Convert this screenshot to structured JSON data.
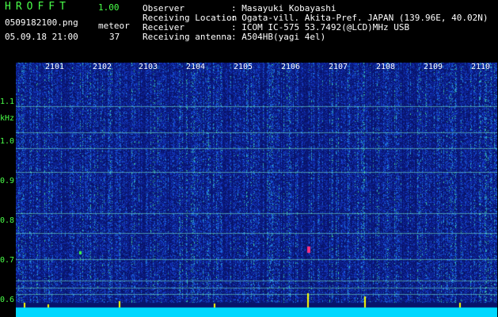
{
  "app": {
    "name": "HROFFT",
    "version": "1.00"
  },
  "file": {
    "name": "0509182100.png",
    "datetime": "05.09.18 21:00"
  },
  "meteor": {
    "label": "meteor",
    "count": "37"
  },
  "info": [
    {
      "label": "Observer",
      "value": ": Masayuki Kobayashi"
    },
    {
      "label": "Receiving Location",
      "value": ": Ogata-vill. Akita-Pref. JAPAN (139.96E, 40.02N)"
    },
    {
      "label": "Receiver",
      "value": ": ICOM IC-575 53.7492(@LCD)MHz USB"
    },
    {
      "label": "Receiving antenna",
      "value": ": A504HB(yagi 4el)"
    }
  ],
  "axis": {
    "y_unit": "kHz",
    "y_ticks": [
      "1.1",
      "1.0",
      "0.9",
      "0.8",
      "0.7",
      "0.6"
    ],
    "x_ticks": [
      "2101",
      "2102",
      "2103",
      "2104",
      "2105",
      "2106",
      "2107",
      "2108",
      "2109",
      "2110"
    ]
  },
  "colors": {
    "text_green": "#49ff49",
    "bg": "#000000",
    "spectrum_low": "#0a1a80",
    "spectrum_high": "#ffff00",
    "baseline": "#00e0ff"
  }
}
